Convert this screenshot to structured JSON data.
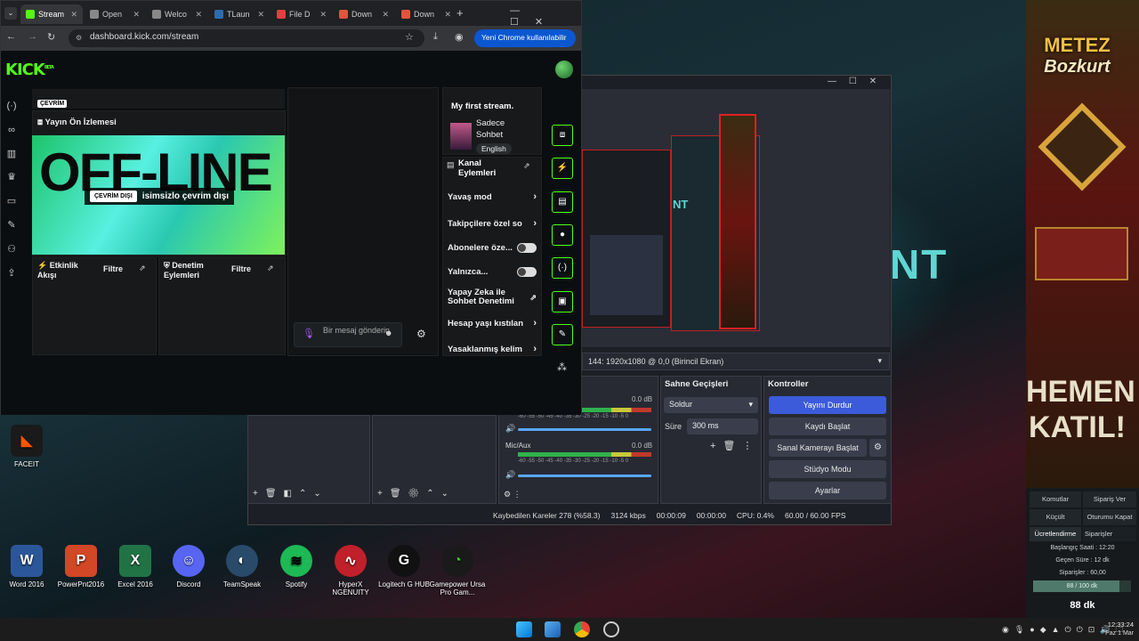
{
  "browser": {
    "tabs": [
      {
        "label": "Stream",
        "color": "#53fc18"
      },
      {
        "label": "Open",
        "color": "#888888"
      },
      {
        "label": "Welco",
        "color": "#888888"
      },
      {
        "label": "TLaun",
        "color": "#2b6cb0"
      },
      {
        "label": "File D",
        "color": "#e53e3e"
      },
      {
        "label": "Down",
        "color": "#e5533e"
      },
      {
        "label": "Down",
        "color": "#e5533e"
      }
    ],
    "url": "dashboard.kick.com/stream",
    "chrome_update": "Yeni Chrome kullanılabilir"
  },
  "kick": {
    "logo": "KICK",
    "logo_beta": "BETA",
    "status_chip": "ÇEVRİM",
    "preview_title": "Yayın Ön İzlemesi",
    "offline_badge": "ÇEVRİM DIŞI",
    "offline_text": "isimsizlo çevrim dışı",
    "preview_art_text": "OFF-LINE",
    "activity_feed": "Etkinlik Akışı",
    "activity_filter": "Filtre",
    "moderation": "Denetim Eylemleri",
    "moderation_filter": "Filtre",
    "chat_placeholder": "Bir mesaj gönderin",
    "stream_title": "My first stream.",
    "category_line1": "Sadece",
    "category_line2": "Sohbet",
    "language": "English",
    "channel_actions": "Kanal Eylemleri",
    "actions": [
      {
        "label": "Yavaş mod",
        "type": "chevron"
      },
      {
        "label": "Takipçilere özel so",
        "type": "chevron"
      },
      {
        "label": "Abonelere öze...",
        "type": "toggle"
      },
      {
        "label": "Yalnızca...",
        "type": "toggle"
      },
      {
        "label": "Yapay Zeka ile Sohbet Denetimi",
        "type": "external"
      },
      {
        "label": "Hesap yaşı kıstılan",
        "type": "chevron"
      },
      {
        "label": "Yasaklanmış kelim",
        "type": "chevron"
      }
    ]
  },
  "obs": {
    "source_line": "144: 1920x1080 @ 0,0 (Birincil Ekran)",
    "scene_transitions": "Sahne Geçişleri",
    "transition": "Soldur",
    "duration_label": "Süre",
    "duration": "300 ms",
    "controls": "Kontroller",
    "buttons": [
      "Yayını Durdur",
      "Kaydı Başlat",
      "Sanal Kamerayı Başlat",
      "Stüdyo Modu",
      "Ayarlar"
    ],
    "mixer": [
      {
        "name": "",
        "db": "0.0 dB"
      },
      {
        "name": "Mic/Aux",
        "db": "0.0 dB"
      }
    ],
    "meter_scale": "-60 -55 -50 -45 -40 -35 -30 -25 -20 -15 -10 -5 0",
    "status": {
      "dropped": "Kaybedilen Kareler 278 (%58.3)",
      "kbps": "3124 kbps",
      "live_time": "00:00:09",
      "rec_time": "00:00:00",
      "cpu": "CPU: 0.4%",
      "fps": "60.00 / 60.00 FPS"
    }
  },
  "overlay": {
    "brand1": "METEZ",
    "brand2": "Bozkurt",
    "promo": "HEMEN KATIL!",
    "stream_logo": "NT"
  },
  "chat_control": {
    "buttons": [
      "Komutlar",
      "Sipariş Ver",
      "Küçült",
      "Oturumu Kapat",
      "Ücretlendirme",
      "Siparişler"
    ],
    "start_time": "Başlangıç Saati :  12:20",
    "elapsed": "Geçen Süre :  12 dk",
    "orders": "Siparişler :  60,00",
    "progress": "88 / 100 dk",
    "progress_fraction": 0.88,
    "remaining": "88 dk"
  },
  "desktop_icons": [
    {
      "label": "FACEIT",
      "color": "#1a1a1a",
      "glyph": "◣"
    },
    {
      "label": "Word 2016",
      "color": "#2b579a",
      "glyph": "W"
    },
    {
      "label": "PowerPnt2016",
      "color": "#d24726",
      "glyph": "P"
    },
    {
      "label": "Excel 2016",
      "color": "#217346",
      "glyph": "X"
    },
    {
      "label": "Discord",
      "color": "#5865f2",
      "glyph": "☺"
    },
    {
      "label": "TeamSpeak",
      "color": "#2a4a6a",
      "glyph": "◐"
    },
    {
      "label": "Spotify",
      "color": "#1db954",
      "glyph": "≋"
    },
    {
      "label": "HyperX NGENUITY",
      "color": "#c0202a",
      "glyph": "∿"
    },
    {
      "label": "Logitech G HUB",
      "color": "#111111",
      "glyph": "G"
    },
    {
      "label": "Gamepower Ursa Pro Gam...",
      "color": "#1a1a1a",
      "glyph": "◔"
    }
  ],
  "clock": {
    "time": "12:33:24",
    "date": "Paz 1 Mar"
  }
}
